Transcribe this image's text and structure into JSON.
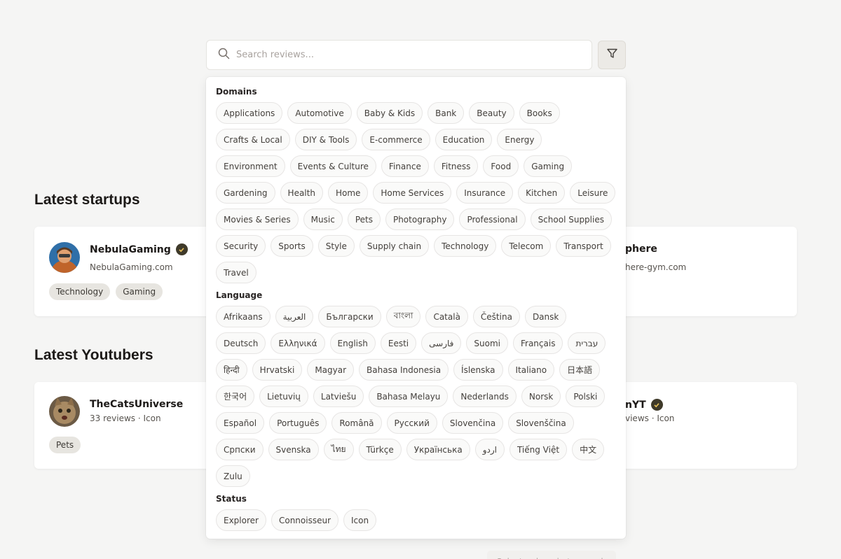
{
  "search": {
    "placeholder": "Search reviews..."
  },
  "background": {
    "startups_title": "Latest startups",
    "youtubers_title": "Latest Youtubers",
    "startup_card_left": {
      "name": "NebulaGaming",
      "sub": "NebulaGaming.com",
      "tags": [
        "Technology",
        "Gaming"
      ],
      "verified": true
    },
    "startup_card_right": {
      "name": "phere",
      "sub": "here-gym.com"
    },
    "youtuber_card_left": {
      "name": "TheCatsUniverse",
      "sub": "33 reviews · Icon",
      "tags": [
        "Pets"
      ]
    },
    "youtuber_card_right": {
      "name": "nYT",
      "sub": "views · Icon",
      "verified": true
    }
  },
  "filters": {
    "domains": {
      "title": "Domains",
      "items": [
        "Applications",
        "Automotive",
        "Baby & Kids",
        "Bank",
        "Beauty",
        "Books",
        "Crafts & Local",
        "DIY & Tools",
        "E-commerce",
        "Education",
        "Energy",
        "Environment",
        "Events & Culture",
        "Finance",
        "Fitness",
        "Food",
        "Gaming",
        "Gardening",
        "Health",
        "Home",
        "Home Services",
        "Insurance",
        "Kitchen",
        "Leisure",
        "Movies & Series",
        "Music",
        "Pets",
        "Photography",
        "Professional",
        "School Supplies",
        "Security",
        "Sports",
        "Style",
        "Supply chain",
        "Technology",
        "Telecom",
        "Transport",
        "Travel"
      ]
    },
    "language": {
      "title": "Language",
      "items": [
        "Afrikaans",
        "العربية",
        "Български",
        "বাংলা",
        "Català",
        "Čeština",
        "Dansk",
        "Deutsch",
        "Ελληνικά",
        "English",
        "Eesti",
        "فارسی",
        "Suomi",
        "Français",
        "עברית",
        "हिन्दी",
        "Hrvatski",
        "Magyar",
        "Bahasa Indonesia",
        "Íslenska",
        "Italiano",
        "日本語",
        "한국어",
        "Lietuvių",
        "Latviešu",
        "Bahasa Melayu",
        "Nederlands",
        "Norsk",
        "Polski",
        "Español",
        "Português",
        "Română",
        "Русский",
        "Slovenčina",
        "Slovenščina",
        "Српски",
        "Svenska",
        "ไทย",
        "Türkçe",
        "Українська",
        "اردو",
        "Tiếng Việt",
        "中文",
        "Zulu"
      ]
    },
    "status": {
      "title": "Status",
      "items": [
        "Explorer",
        "Connoisseur",
        "Icon"
      ]
    },
    "submit_label": "Select a domain to search"
  }
}
